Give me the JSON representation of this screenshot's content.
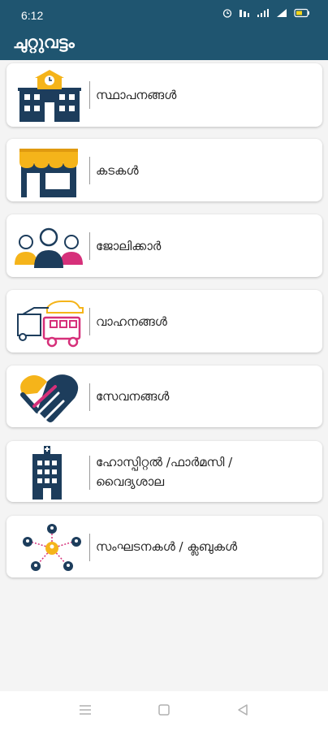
{
  "status_bar": {
    "time": "6:12"
  },
  "app": {
    "title": "ചുറ്റുവട്ടം"
  },
  "categories": [
    {
      "label": "സ്ഥാപനങ്ങൾ",
      "icon": "institution-building-icon"
    },
    {
      "label": "കടകൾ",
      "icon": "shop-store-icon"
    },
    {
      "label": "ജോലിക്കാർ",
      "icon": "workers-people-icon"
    },
    {
      "label": "വാഹനങ്ങൾ",
      "icon": "vehicles-icon"
    },
    {
      "label": "സേവനങ്ങൾ",
      "icon": "service-handshake-icon"
    },
    {
      "label_line1": "ഹോസ്പിറ്റൽ /ഫാർമസി /",
      "label_line2": "വൈദ്യശാല",
      "icon": "hospital-building-icon"
    },
    {
      "label": "സംഘടനകൾ / ക്ലബുകൾ",
      "icon": "organization-network-icon"
    }
  ],
  "colors": {
    "primary": "#1f5570",
    "accent_yellow": "#f5b41a",
    "accent_magenta": "#d6307a",
    "navy": "#1d3d5c"
  }
}
